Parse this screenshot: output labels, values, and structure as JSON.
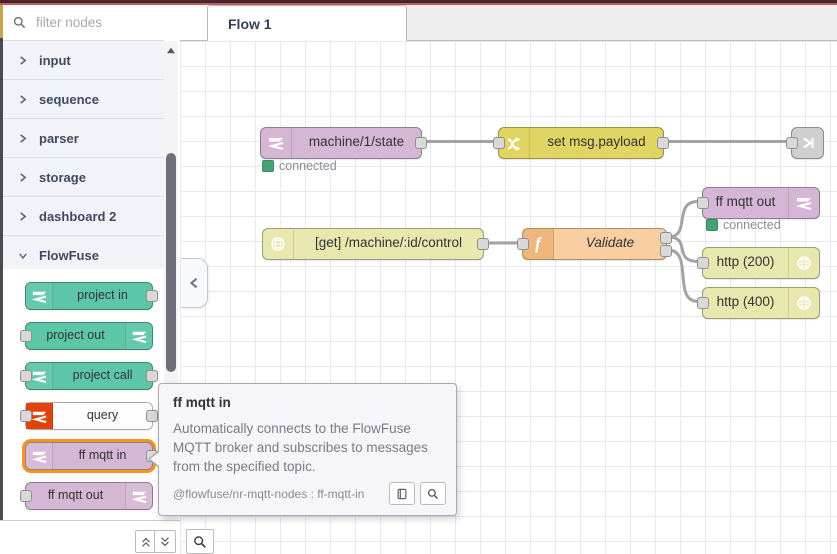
{
  "palette": {
    "filter_placeholder": "filter nodes",
    "categories": [
      {
        "label": "input",
        "expanded": false
      },
      {
        "label": "sequence",
        "expanded": false
      },
      {
        "label": "parser",
        "expanded": false
      },
      {
        "label": "storage",
        "expanded": false
      },
      {
        "label": "dashboard 2",
        "expanded": false
      },
      {
        "label": "FlowFuse",
        "expanded": true
      }
    ],
    "nodes": [
      {
        "label": "project in"
      },
      {
        "label": "project out"
      },
      {
        "label": "project call"
      },
      {
        "label": "query"
      },
      {
        "label": "ff mqtt in",
        "highlighted": true
      },
      {
        "label": "ff mqtt out"
      }
    ]
  },
  "tabs": [
    {
      "label": "Flow 1",
      "active": true
    }
  ],
  "flow": {
    "nodes": [
      {
        "label": "machine/1/state",
        "type": "ff mqtt in",
        "status": "connected"
      },
      {
        "label": "set msg.payload",
        "type": "change"
      },
      {
        "label": "",
        "type": "link out"
      },
      {
        "label": "[get] /machine/:id/control",
        "type": "http in"
      },
      {
        "label": "Validate",
        "type": "function"
      },
      {
        "label": "ff mqtt out",
        "type": "ff mqtt out",
        "status": "connected"
      },
      {
        "label": "http (200)",
        "type": "http response"
      },
      {
        "label": "http (400)",
        "type": "http response"
      }
    ]
  },
  "tooltip": {
    "title": "ff mqtt in",
    "body": "Automatically connects to the FlowFuse MQTT broker and subscribes to messages from the specified topic.",
    "meta": "@flowfuse/nr-mqtt-nodes : ff-mqtt-in"
  },
  "icons": {
    "search": "magnifier",
    "category_collapsed": "chevron-right",
    "category_expanded": "chevron-down",
    "flowfuse": "flowfuse-logo",
    "change": "shuffle-arrows",
    "http": "globe",
    "function_glyph": "f",
    "link_out": "arrow-out",
    "help": "book",
    "scroll_up": "triangle-up",
    "collapse_all": "double-chevron-up",
    "expand_all": "double-chevron-down",
    "palette_toggle": "chevron-left",
    "zoom_search": "magnifier"
  },
  "colors": {
    "header_red": "#cf5752",
    "teal": "#5dc6a9",
    "mauve": "#d5b7d5",
    "change_yellow": "#e0d463",
    "http_yellow": "#e7e7ae",
    "function_orange": "#f9cfa2",
    "query_red": "#e0440b",
    "link_grey": "#cfcfcf",
    "status_green": "#44a373",
    "highlight_orange": "#f7941d",
    "wire_grey": "#a3a3a3"
  }
}
